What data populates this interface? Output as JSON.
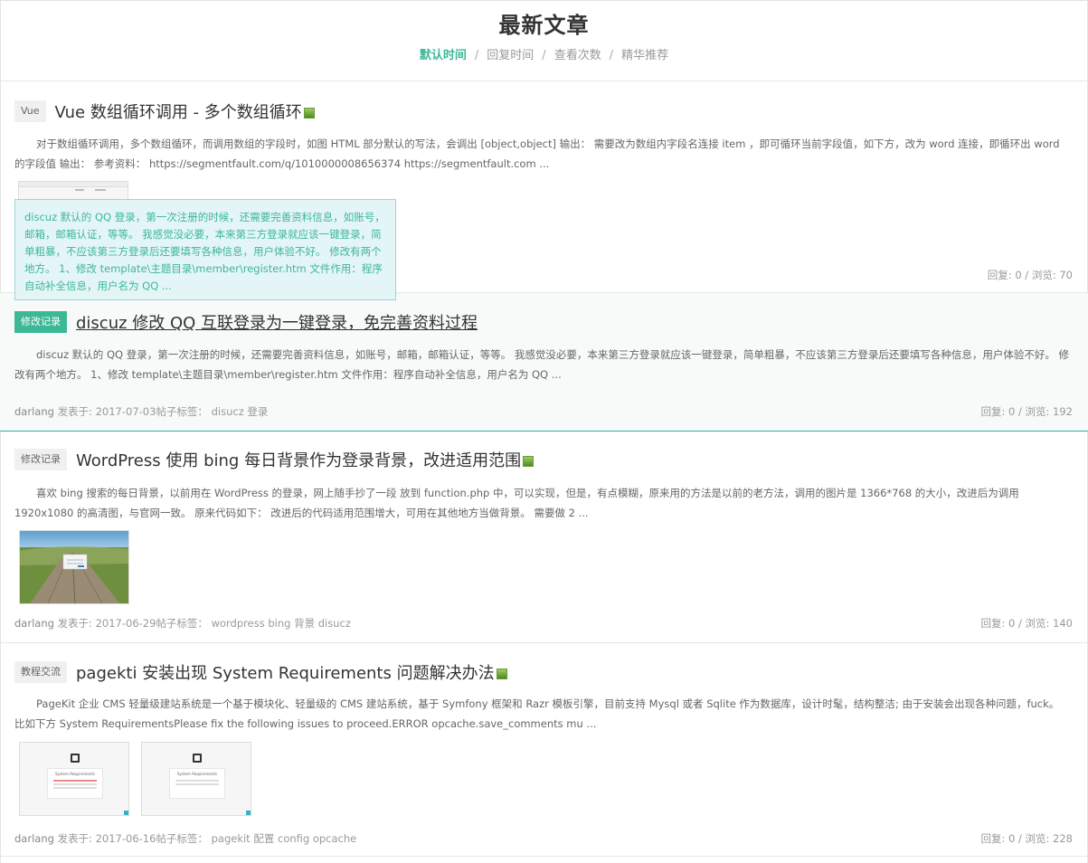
{
  "header": {
    "title": "最新文章",
    "sort_tabs": [
      {
        "label": "默认时间",
        "active": true
      },
      {
        "label": "回复时间",
        "active": false
      },
      {
        "label": "查看次数",
        "active": false
      },
      {
        "label": "精华推荐",
        "active": false
      }
    ],
    "separator": "/"
  },
  "tooltip": {
    "text": "discuz 默认的 QQ 登录，第一次注册的时候，还需要完善资料信息，如账号，邮箱，邮箱认证，等等。 我感觉没必要，本来第三方登录就应该一键登录，简单粗暴，不应该第三方登录后还要填写各种信息，用户体验不好。 修改有两个地方。 1、修改 template\\主题目录\\member\\register.htm 文件作用：程序自动补全信息，用户名为 QQ ..."
  },
  "posts": [
    {
      "tag": "Vue",
      "title": "Vue 数组循环调用 - 多个数组循环",
      "excerpt": "对于数组循环调用，多个数组循环，而调用数组的字段时，如图 HTML 部分默认的写法，会调出 [object,object] 输出： 需要改为数组内字段名连接 item ，即可循环当前字段值，如下方，改为 word 连接，即循环出 word 的字段值 输出： 参考资料： https://segmentfault.com/q/1010000008656374 https://segmentfault.com ...",
      "stats": "回复: 0 / 浏览: 70"
    },
    {
      "tag": "修改记录",
      "title": "discuz 修改 QQ 互联登录为一键登录，免完善资料过程",
      "excerpt": "discuz 默认的 QQ 登录，第一次注册的时候，还需要完善资料信息，如账号，邮箱，邮箱认证，等等。 我感觉没必要，本来第三方登录就应该一键登录，简单粗暴，不应该第三方登录后还要填写各种信息，用户体验不好。 修改有两个地方。 1、修改 template\\主题目录\\member\\register.htm 文件作用：程序自动补全信息，用户名为 QQ ...",
      "author": "darlang",
      "posted_label": "发表于:",
      "date": "2017-07-03",
      "tags_label": "帖子标签：",
      "tag_list": "disucz 登录",
      "stats": "回复: 0 / 浏览: 192"
    },
    {
      "tag": "修改记录",
      "title": "WordPress 使用 bing 每日背景作为登录背景，改进适用范围",
      "excerpt": "喜欢 bing 搜索的每日背景，以前用在 WordPress 的登录，网上随手抄了一段 放到 function.php 中，可以实现，但是，有点模糊，原来用的方法是以前的老方法，调用的图片是 1366*768 的大小，改进后为调用 1920x1080 的高清图，与官网一致。 原来代码如下： 改进后的代码适用范围增大，可用在其他地方当做背景。 需要做 2 ...",
      "author": "darlang",
      "posted_label": "发表于:",
      "date": "2017-06-29",
      "tags_label": "帖子标签：",
      "tag_list": "wordpress bing 背景 disucz",
      "stats": "回复: 0 / 浏览: 140"
    },
    {
      "tag": "教程交流",
      "title": "pagekti 安装出现 System Requirements 问题解决办法",
      "excerpt": "PageKit 企业 CMS 轻量级建站系统是一个基于模块化、轻量级的 CMS 建站系统，基于 Symfony 框架和 Razr 模板引擎，目前支持 Mysql 或者 Sqlite 作为数据库，设计时髦，结构整洁; 由于安装会出现各种问题，fuck。 比如下方 System RequirementsPlease fix the following issues to proceed.ERROR opcache.save_comments mu ...",
      "author": "darlang",
      "posted_label": "发表于:",
      "date": "2017-06-16",
      "tags_label": "帖子标签：",
      "tag_list": "pagekit 配置 config opcache",
      "stats": "回复: 0 / 浏览: 228",
      "thumb_text": "System Requirements"
    }
  ],
  "colors": {
    "accent": "#3cb896",
    "tooltip_bg": "#e4f5f7",
    "tooltip_border": "#9fd4d8"
  }
}
